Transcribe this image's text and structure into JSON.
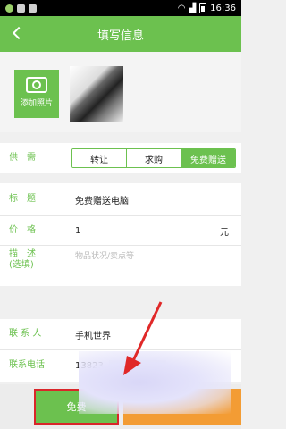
{
  "status_bar": {
    "time": "16:36"
  },
  "app_bar": {
    "title": "填写信息"
  },
  "photos": {
    "add_label": "添加照片"
  },
  "supply_demand": {
    "label": "供　需",
    "options": [
      "转让",
      "求购",
      "免费赠送"
    ],
    "selected": "免费赠送"
  },
  "form": {
    "title_label": "标　题",
    "title_value": "免费赠送电脑",
    "price_label": "价　格",
    "price_value": "1",
    "price_unit": "元",
    "desc_label": "描　述",
    "desc_sub": "(选填)",
    "desc_placeholder": "物品状况/卖点等"
  },
  "contact": {
    "person_label": "联 系 人",
    "person_value": "手机世界",
    "phone_label": "联系电话",
    "phone_value": "13823"
  },
  "bottom": {
    "primary_label": "免费"
  },
  "colors": {
    "brand_green": "#6cc14f",
    "highlight_red": "#d9262a",
    "accent_orange": "#f39c34"
  }
}
